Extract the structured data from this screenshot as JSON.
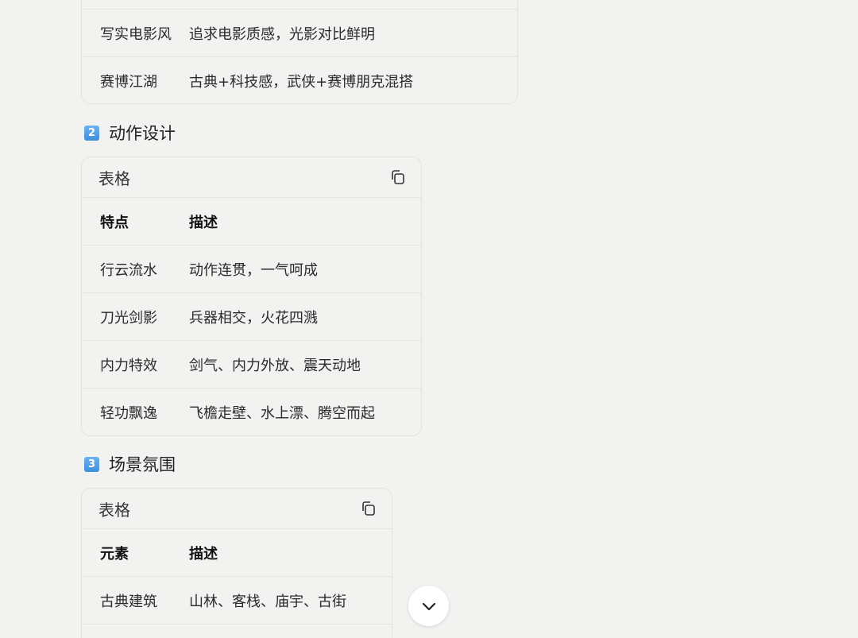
{
  "table1": {
    "rows": [
      {
        "c1": "写实电影风",
        "c2": "追求电影质感，光影对比鲜明"
      },
      {
        "c1": "赛博江湖",
        "c2": "古典+科技感，武侠+赛博朋克混搭"
      }
    ]
  },
  "section2": {
    "number": "2",
    "title": "动作设计"
  },
  "table2": {
    "label": "表格",
    "header": {
      "c1": "特点",
      "c2": "描述"
    },
    "rows": [
      {
        "c1": "行云流水",
        "c2": "动作连贯，一气呵成"
      },
      {
        "c1": "刀光剑影",
        "c2": "兵器相交，火花四溅"
      },
      {
        "c1": "内力特效",
        "c2": "剑气、内力外放、震天动地"
      },
      {
        "c1": "轻功飘逸",
        "c2": "飞檐走壁、水上漂、腾空而起"
      }
    ]
  },
  "section3": {
    "number": "3",
    "title": "场景氛围"
  },
  "table3": {
    "label": "表格",
    "header": {
      "c1": "元素",
      "c2": "描述"
    },
    "rows": [
      {
        "c1": "古典建筑",
        "c2": "山林、客栈、庙宇、古街"
      }
    ]
  },
  "icons": {
    "copy": "copy-icon",
    "scroll_down": "chevron-down-icon"
  }
}
